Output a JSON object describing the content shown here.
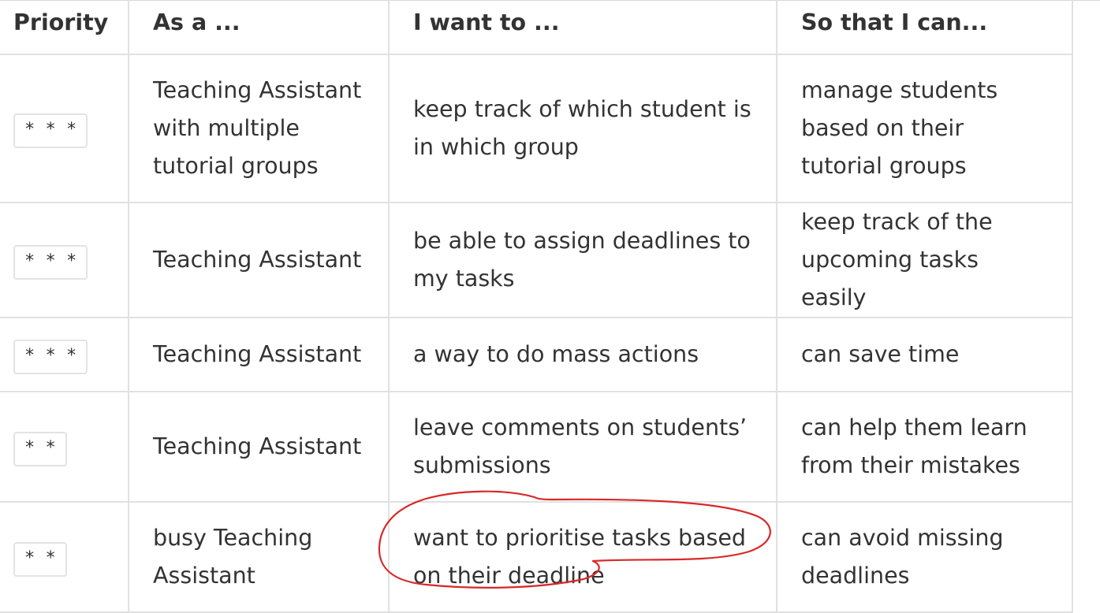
{
  "table": {
    "headers": [
      "Priority",
      "As a ...",
      "I want to ...",
      "So that I can..."
    ],
    "rows": [
      {
        "priority": "* * *",
        "as_a": "Teaching Assistant with multiple tutorial groups",
        "i_want_to": "keep track of which student is in which group",
        "so_that": "manage students based on their tutorial groups"
      },
      {
        "priority": "* * *",
        "as_a": "Teaching Assistant",
        "i_want_to": "be able to assign deadlines to my tasks",
        "so_that": "keep track of the upcoming tasks easily"
      },
      {
        "priority": "* * *",
        "as_a": "Teaching Assistant",
        "i_want_to": "a way to do mass actions",
        "so_that": "can save time"
      },
      {
        "priority": "* *",
        "as_a": "Teaching Assistant",
        "i_want_to": "leave comments on students’ submissions",
        "so_that": "can help them learn from their mistakes"
      },
      {
        "priority": "* *",
        "as_a": "busy Teaching Assistant",
        "i_want_to": "want to prioritise tasks based on their deadline",
        "so_that": "can avoid missing deadlines"
      }
    ]
  },
  "annotation": {
    "stroke_color": "#d82828"
  }
}
